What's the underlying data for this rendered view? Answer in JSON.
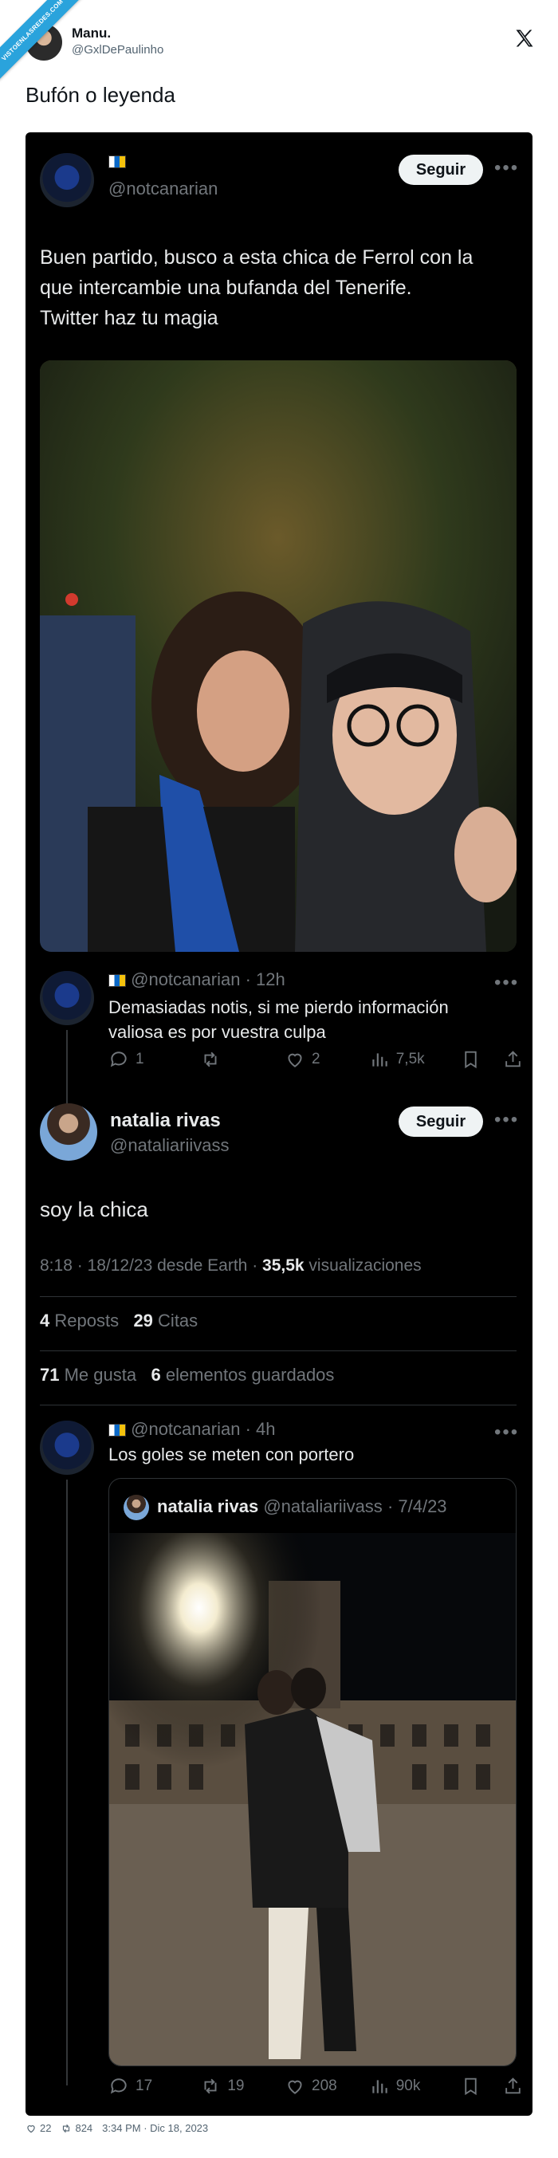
{
  "watermark": {
    "text": "VISTOENLASREDES.COM"
  },
  "outer_tweet": {
    "author_name": "Manu.",
    "author_handle": "@GxlDePaulinho",
    "text": "Bufón o leyenda",
    "footer": {
      "likes": "22",
      "retweets": "824",
      "timestamp": "3:34 PM · Dic 18, 2023"
    }
  },
  "tweet1": {
    "handle": "@notcanarian",
    "follow_label": "Seguir",
    "text_lines": [
      "Buen partido, busco a esta chica de Ferrol con la",
      "que intercambie una bufanda del Tenerife.",
      "Twitter haz tu magia"
    ]
  },
  "reply1": {
    "handle": "@notcanarian",
    "time": "· 12h",
    "text_lines": [
      "Demasiadas notis, si me pierdo información",
      "valiosa es por vuestra culpa"
    ],
    "stats": {
      "replies": "1",
      "retweets": "",
      "likes": "2",
      "views": "7,5k"
    }
  },
  "tweet2": {
    "name": "natalia rivas",
    "handle": "@nataliariivass",
    "follow_label": "Seguir",
    "text": "soy la chica",
    "meta_time": "8:18 · 18/12/23 desde Earth · ",
    "meta_views": "35,5k",
    "meta_views_label": " visualizaciones",
    "reposts": "4",
    "reposts_label": "Reposts",
    "quotes": "29",
    "quotes_label": "Citas",
    "likes": "71",
    "likes_label": "Me gusta",
    "saves": "6",
    "saves_label": "elementos guardados"
  },
  "reply2": {
    "handle": "@notcanarian",
    "time": "· 4h",
    "text": "Los goles se meten con portero",
    "quote": {
      "name": "natalia rivas",
      "handle": "@nataliariivass",
      "date": "· 7/4/23"
    },
    "stats": {
      "replies": "17",
      "retweets": "19",
      "likes": "208",
      "views": "90k"
    }
  },
  "colors": {
    "card_bg": "#000000",
    "muted": "#71767b",
    "accent_flag_blue": "#0a68c7",
    "accent_flag_yellow": "#f4c20d"
  }
}
